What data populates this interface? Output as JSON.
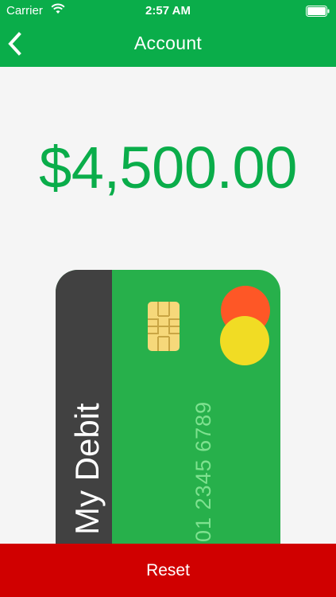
{
  "status_bar": {
    "carrier": "Carrier",
    "time": "2:57 AM",
    "wifi_icon": "wifi-icon",
    "battery_icon": "battery-icon"
  },
  "nav": {
    "title": "Account",
    "back_icon": "chevron-left-icon"
  },
  "balance": "$4,500.00",
  "card": {
    "name": "My Debit",
    "number": "01 2345 6789"
  },
  "actions": {
    "reset_label": "Reset"
  },
  "colors": {
    "brand_green": "#0aad4a",
    "card_green": "#27b04b",
    "card_side": "#414141",
    "reset_red": "#d00000",
    "logo_red": "#fe5726",
    "logo_yellow": "#f1dc24"
  }
}
